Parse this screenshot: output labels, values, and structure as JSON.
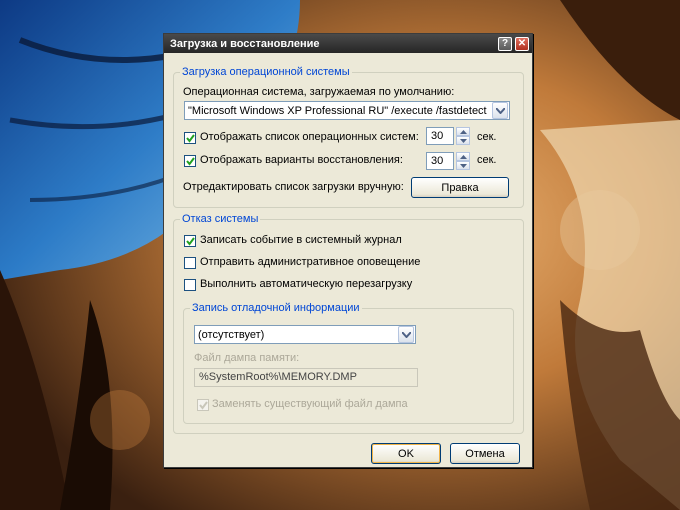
{
  "dialog": {
    "title": "Загрузка и восстановление",
    "help_button": "?",
    "close_button": "✕"
  },
  "startup": {
    "group_label": "Загрузка операционной системы",
    "default_os_label": "Операционная система, загружаемая по умолчанию:",
    "default_os_value": "\"Microsoft Windows XP Professional RU\" /execute /fastdetect",
    "show_os_list_label": "Отображать список операционных систем:",
    "show_os_list_checked": true,
    "show_os_list_value": "30",
    "show_recovery_label": "Отображать варианты восстановления:",
    "show_recovery_checked": true,
    "show_recovery_value": "30",
    "seconds_unit": "сек.",
    "edit_list_label": "Отредактировать список загрузки вручную:",
    "edit_button": "Правка"
  },
  "failure": {
    "group_label": "Отказ системы",
    "write_event_label": "Записать событие в системный журнал",
    "write_event_checked": true,
    "send_alert_label": "Отправить административное оповещение",
    "send_alert_checked": false,
    "auto_restart_label": "Выполнить автоматическую перезагрузку",
    "auto_restart_checked": false
  },
  "debug": {
    "group_label": "Запись отладочной информации",
    "type_value": "(отсутствует)",
    "dump_file_label": "Файл дампа памяти:",
    "dump_file_value": "%SystemRoot%\\MEMORY.DMP",
    "overwrite_label": "Заменять существующий файл дампа",
    "overwrite_checked": true
  },
  "buttons": {
    "ok": "OK",
    "cancel": "Отмена"
  },
  "colors": {
    "group_label": "#0046d5",
    "titlebar": "#333333",
    "dialog_bg": "#ece9d8"
  }
}
